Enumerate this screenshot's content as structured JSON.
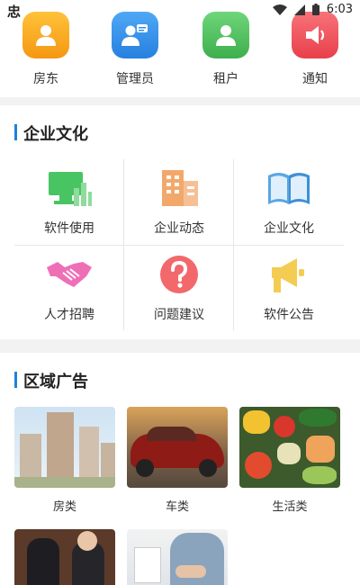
{
  "status_bar": {
    "app_glyph": "忠",
    "time": "6:03"
  },
  "roles": [
    {
      "label": "房东",
      "icon": "person-icon",
      "color": "#f7a21b"
    },
    {
      "label": "管理员",
      "icon": "admin-icon",
      "color": "#2f8ee8"
    },
    {
      "label": "租户",
      "icon": "person-icon",
      "color": "#4cc35b"
    },
    {
      "label": "通知",
      "icon": "speaker-icon",
      "color": "#f0525c"
    }
  ],
  "culture": {
    "title": "企业文化",
    "items": [
      {
        "label": "软件使用",
        "icon": "monitor-chart-icon"
      },
      {
        "label": "企业动态",
        "icon": "building-icon"
      },
      {
        "label": "企业文化",
        "icon": "book-icon"
      },
      {
        "label": "人才招聘",
        "icon": "handshake-icon"
      },
      {
        "label": "问题建议",
        "icon": "question-icon"
      },
      {
        "label": "软件公告",
        "icon": "megaphone-icon"
      }
    ]
  },
  "ads": {
    "title": "区域广告",
    "items": [
      {
        "label": "房类",
        "image": "apartment-buildings-photo"
      },
      {
        "label": "车类",
        "image": "red-car-photo"
      },
      {
        "label": "生活类",
        "image": "vegetables-photo"
      },
      {
        "label": "",
        "image": "business-people-photo"
      },
      {
        "label": "",
        "image": "office-meeting-photo"
      }
    ]
  }
}
